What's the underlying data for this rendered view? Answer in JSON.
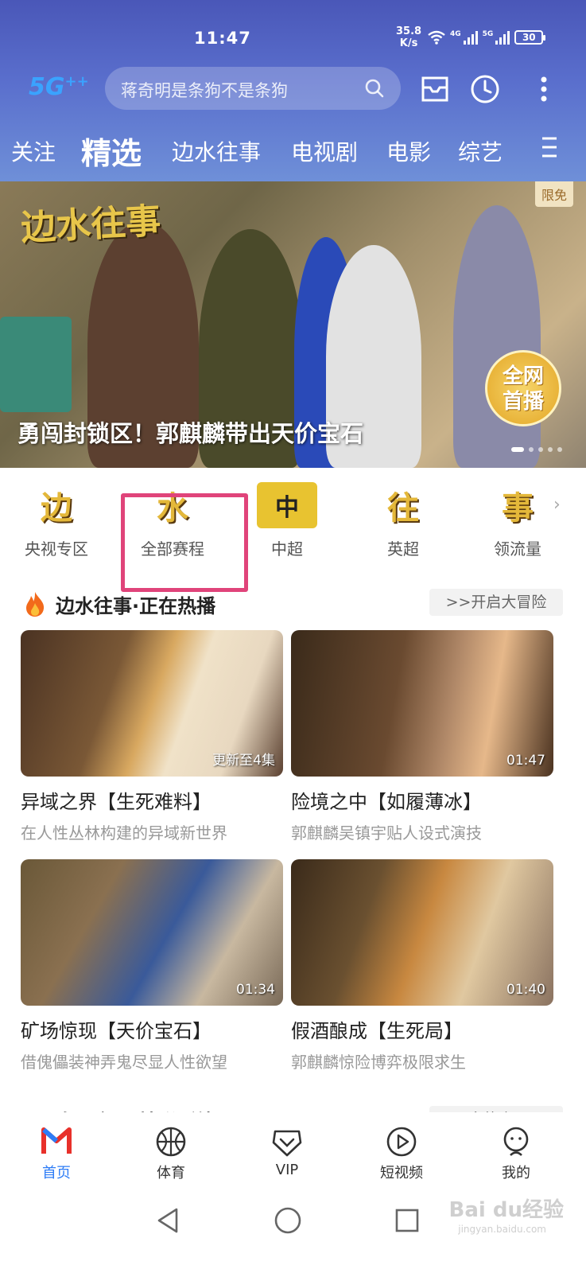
{
  "status_bar": {
    "time": "11:47",
    "speed_value": "35.8",
    "speed_unit": "K/s",
    "sig1_tag": "4G",
    "sig2_tag": "5G",
    "battery": "30"
  },
  "header": {
    "logo": "5G",
    "logo_sup": "++",
    "search_placeholder": "蒋奇明是条狗不是条狗"
  },
  "tabs": [
    "关注",
    "精选",
    "边水往事",
    "电视剧",
    "电影",
    "综艺"
  ],
  "banner": {
    "art_title": "边水往事",
    "free_tag": "限免",
    "badge_line1": "全网",
    "badge_line2": "首播",
    "caption": "勇闯封锁区！郭麒麟带出天价宝石"
  },
  "channels": [
    {
      "art": "边",
      "label": "央视专区"
    },
    {
      "art": "水",
      "label": "全部赛程"
    },
    {
      "art": "中",
      "label": "中超"
    },
    {
      "art": "往",
      "label": "英超"
    },
    {
      "art": "事",
      "label": "领流量"
    }
  ],
  "section": {
    "title": "边水往事·正在热播",
    "more": ">>开启大冒险"
  },
  "videos": [
    {
      "badge": "更新至4集",
      "title": "异域之界【生死难料】",
      "sub": "在人性丛林构建的异域新世界"
    },
    {
      "badge": "01:47",
      "title": "险境之中【如履薄冰】",
      "sub": "郭麒麟吴镇宇贴人设式演技"
    },
    {
      "badge": "01:34",
      "title": "矿场惊现【天价宝石】",
      "sub": "借傀儡装神弄鬼尽显人性欲望"
    },
    {
      "badge": "01:40",
      "title": "假酒酿成【生死局】",
      "sub": "郭麒麟惊险博弈极限求生"
    }
  ],
  "next_section": {
    "title": "奥运之夏 精彩延续",
    "more": "更多热点>>"
  },
  "bottom_tabs": [
    {
      "label": "首页",
      "active": true
    },
    {
      "label": "体育",
      "active": false
    },
    {
      "label": "VIP",
      "active": false
    },
    {
      "label": "短视频",
      "active": false
    },
    {
      "label": "我的",
      "active": false
    }
  ],
  "watermark": {
    "main": "Bai du经验",
    "sub": "jingyan.baidu.com"
  },
  "colors": {
    "accent": "#2d7cf6",
    "highlight": "#e0447a",
    "header_top": "#4a57b8"
  }
}
